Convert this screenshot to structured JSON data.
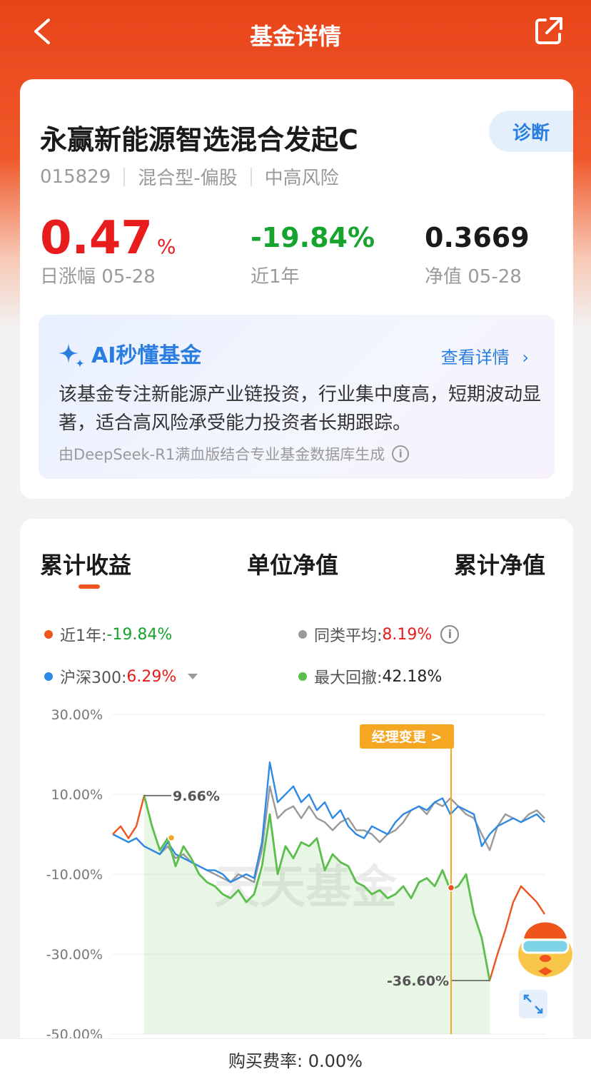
{
  "header": {
    "title": "基金详情"
  },
  "fund": {
    "name": "永赢新能源智选混合发起C",
    "diagnose_label": "诊断",
    "code": "015829",
    "type": "混合型-偏股",
    "risk": "中高风险",
    "daily_change": "0.47",
    "daily_change_unit": "%",
    "daily_change_label": "日涨幅 05-28",
    "year_change": "-19.84%",
    "year_change_label": "近1年",
    "nav": "0.3669",
    "nav_label": "净值 05-28"
  },
  "ai": {
    "title": "AI秒懂基金",
    "more": "查看详情",
    "text": "该基金专注新能源产业链投资，行业集中度高，短期波动显著，适合高风险承受能力投资者长期跟踪。",
    "source": "由DeepSeek-R1满血版结合专业基金数据库生成"
  },
  "tabs": [
    "累计收益",
    "单位净值",
    "累计净值"
  ],
  "legend": {
    "fund_label": "近1年:",
    "fund_value": "-19.84%",
    "peer_label": "同类平均:",
    "peer_value": "8.19%",
    "index_label": "沪深300:",
    "index_value": "6.29%",
    "drawdown_label": "最大回撤:",
    "drawdown_value": "42.18%"
  },
  "colors": {
    "fund": "#f0541d",
    "peer": "#999999",
    "index": "#2f8ae5",
    "drawdown": "#5bbf4e",
    "up": "#e81c1c",
    "down": "#16a32e"
  },
  "chart_data": {
    "type": "line",
    "y_ticks": [
      "30.00%",
      "10.00%",
      "-10.00%",
      "-30.00%",
      "-50.00%"
    ],
    "ylim": [
      -50,
      30
    ],
    "annotations": {
      "peak_label": "9.66%",
      "trough_label": "-36.60%",
      "manager_change": "经理变更 >",
      "watermark": "天天基金"
    },
    "series": [
      {
        "name": "近1年",
        "values": [
          0,
          2,
          -1,
          2,
          9.66,
          2,
          -4,
          -1,
          -8,
          -3,
          -6,
          -10,
          -12,
          -13,
          -15,
          -16,
          -14,
          -17,
          -15,
          -8,
          5,
          -10,
          -3,
          -6,
          -2,
          -3,
          -1,
          -9,
          -5,
          -7,
          -8,
          -12,
          -13,
          -15,
          -14,
          -16,
          -15,
          -13,
          -16,
          -12,
          -11,
          -13,
          -9,
          -14,
          -13,
          -10,
          -20,
          -26,
          -36.6,
          -30,
          -24,
          -17,
          -13,
          -15,
          -17,
          -20
        ]
      },
      {
        "name": "同类平均",
        "values": [
          0,
          -1,
          -2,
          -1,
          -3,
          -4,
          -5,
          -3,
          -6,
          -5,
          -7,
          -8,
          -9,
          -10,
          -11,
          -12,
          -10,
          -11,
          -12,
          -4,
          12,
          4,
          6,
          7,
          4,
          7,
          4,
          3,
          1,
          3,
          4,
          1,
          1,
          0,
          -2,
          0,
          1,
          3,
          6,
          7,
          5,
          8,
          7,
          9,
          7,
          5,
          4,
          0,
          -4,
          2,
          5,
          4,
          3,
          5,
          6,
          4
        ]
      },
      {
        "name": "沪深300",
        "values": [
          0,
          -1,
          -2,
          -1,
          -3,
          -4,
          -5,
          -2,
          -5,
          -6,
          -7,
          -8,
          -9,
          -9,
          -10,
          -12,
          -11,
          -10,
          -11,
          -2,
          18,
          8,
          10,
          12,
          8,
          10,
          6,
          8,
          4,
          6,
          2,
          0,
          -1,
          2,
          1,
          0,
          3,
          5,
          6,
          7,
          6,
          8,
          9,
          5,
          7,
          6,
          5,
          -3,
          0,
          2,
          3,
          4,
          3,
          4,
          5,
          3
        ]
      }
    ]
  },
  "footer": {
    "fee": "购买费率: 0.00%"
  }
}
